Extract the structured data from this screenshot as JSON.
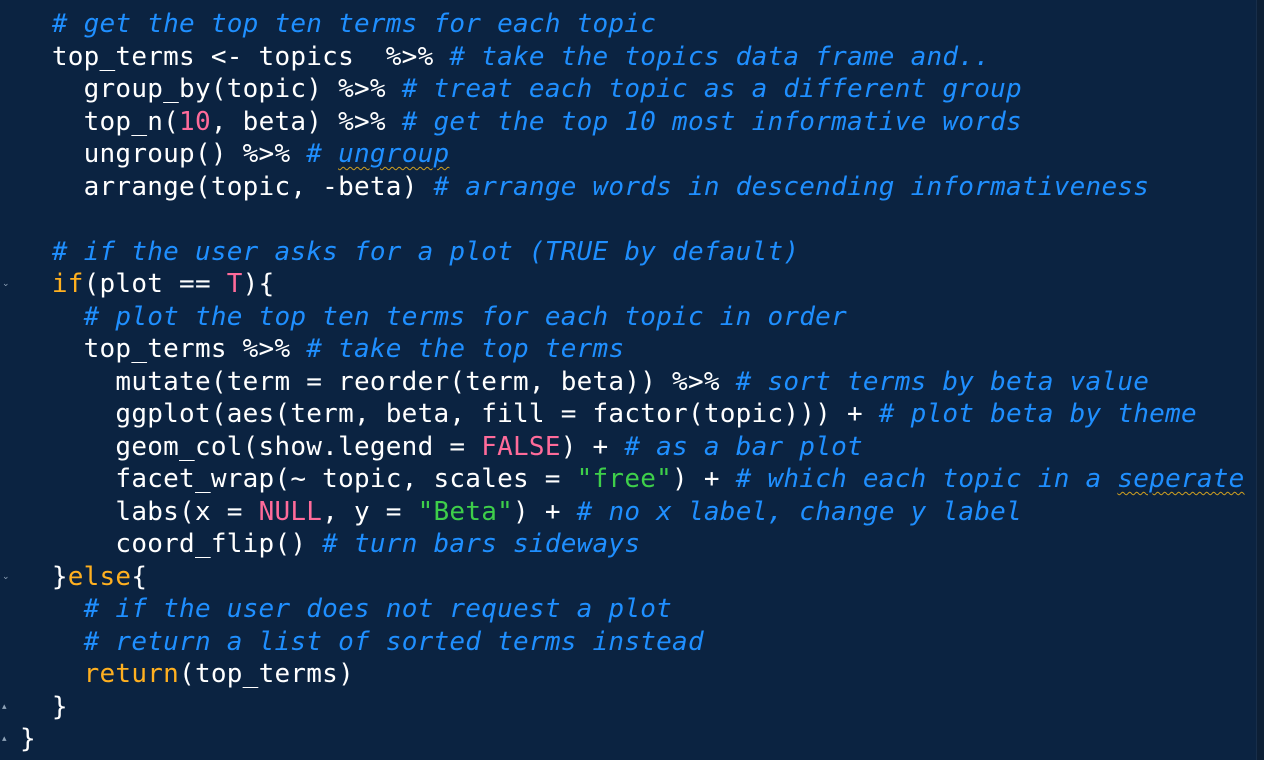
{
  "code_lines": [
    {
      "indent": "  ",
      "tokens": [
        {
          "t": "# get the top ten terms for each topic",
          "k": "c"
        }
      ]
    },
    {
      "indent": "  ",
      "tokens": [
        {
          "t": "top_terms <- topics  %>% ",
          "k": "p"
        },
        {
          "t": "# take the topics data frame and..",
          "k": "c"
        }
      ]
    },
    {
      "indent": "    ",
      "tokens": [
        {
          "t": "group_by(topic) %>% ",
          "k": "p"
        },
        {
          "t": "# treat each topic as a different group",
          "k": "c"
        }
      ]
    },
    {
      "indent": "    ",
      "tokens": [
        {
          "t": "top_n(",
          "k": "p"
        },
        {
          "t": "10",
          "k": "n"
        },
        {
          "t": ", beta) %>% ",
          "k": "p"
        },
        {
          "t": "# get the top 10 most informative words",
          "k": "c"
        }
      ]
    },
    {
      "indent": "    ",
      "tokens": [
        {
          "t": "ungroup() %>% ",
          "k": "p"
        },
        {
          "t": "# ",
          "k": "c"
        },
        {
          "t": "ungroup",
          "k": "c sq"
        }
      ]
    },
    {
      "indent": "    ",
      "tokens": [
        {
          "t": "arrange(topic, -beta) ",
          "k": "p"
        },
        {
          "t": "# arrange words in descending informativeness",
          "k": "c"
        }
      ]
    },
    {
      "indent": "",
      "tokens": []
    },
    {
      "indent": "  ",
      "tokens": [
        {
          "t": "# if the user asks for a plot (TRUE by default)",
          "k": "c"
        }
      ]
    },
    {
      "indent": "  ",
      "tokens": [
        {
          "t": "if",
          "k": "kw"
        },
        {
          "t": "(plot == ",
          "k": "p"
        },
        {
          "t": "T",
          "k": "n"
        },
        {
          "t": "){",
          "k": "p"
        }
      ]
    },
    {
      "indent": "    ",
      "tokens": [
        {
          "t": "# plot the top ten terms for each topic in order",
          "k": "c"
        }
      ]
    },
    {
      "indent": "    ",
      "tokens": [
        {
          "t": "top_terms %>% ",
          "k": "p"
        },
        {
          "t": "# take the top terms",
          "k": "c"
        }
      ]
    },
    {
      "indent": "      ",
      "tokens": [
        {
          "t": "mutate(term = reorder(term, beta)) %>% ",
          "k": "p"
        },
        {
          "t": "# sort terms by beta value",
          "k": "c"
        }
      ]
    },
    {
      "indent": "      ",
      "tokens": [
        {
          "t": "ggplot(aes(term, beta, fill = factor(topic))) + ",
          "k": "p"
        },
        {
          "t": "# plot beta by theme",
          "k": "c"
        }
      ]
    },
    {
      "indent": "      ",
      "tokens": [
        {
          "t": "geom_col(show.legend = ",
          "k": "p"
        },
        {
          "t": "FALSE",
          "k": "n"
        },
        {
          "t": ") + ",
          "k": "p"
        },
        {
          "t": "# as a bar plot",
          "k": "c"
        }
      ]
    },
    {
      "indent": "      ",
      "tokens": [
        {
          "t": "facet_wrap(~ topic, scales = ",
          "k": "p"
        },
        {
          "t": "\"free\"",
          "k": "s"
        },
        {
          "t": ") + ",
          "k": "p"
        },
        {
          "t": "# which each topic in a ",
          "k": "c"
        },
        {
          "t": "seperate",
          "k": "c sq"
        }
      ]
    },
    {
      "indent": "      ",
      "tokens": [
        {
          "t": "labs(x = ",
          "k": "p"
        },
        {
          "t": "NULL",
          "k": "n"
        },
        {
          "t": ", y = ",
          "k": "p"
        },
        {
          "t": "\"Beta\"",
          "k": "s"
        },
        {
          "t": ") + ",
          "k": "p"
        },
        {
          "t": "# no x label, change y label",
          "k": "c"
        }
      ]
    },
    {
      "indent": "      ",
      "tokens": [
        {
          "t": "coord_flip() ",
          "k": "p"
        },
        {
          "t": "# turn bars sideways",
          "k": "c"
        }
      ]
    },
    {
      "indent": "  ",
      "tokens": [
        {
          "t": "}",
          "k": "p"
        },
        {
          "t": "else",
          "k": "kw"
        },
        {
          "t": "{",
          "k": "p"
        }
      ]
    },
    {
      "indent": "    ",
      "tokens": [
        {
          "t": "# if the user does not request a plot",
          "k": "c"
        }
      ]
    },
    {
      "indent": "    ",
      "tokens": [
        {
          "t": "# return a list of sorted terms instead",
          "k": "c"
        }
      ]
    },
    {
      "indent": "    ",
      "tokens": [
        {
          "t": "return",
          "k": "kw"
        },
        {
          "t": "(top_terms)",
          "k": "p"
        }
      ]
    },
    {
      "indent": "  ",
      "tokens": [
        {
          "t": "}",
          "k": "p"
        }
      ]
    },
    {
      "indent": "",
      "tokens": [
        {
          "t": "}",
          "k": "p"
        }
      ]
    }
  ],
  "fold_markers": [
    {
      "line": 8,
      "glyph": "⌄"
    },
    {
      "line": 17,
      "glyph": "⌄"
    },
    {
      "line": 21,
      "glyph": "▴"
    },
    {
      "line": 22,
      "glyph": "▴"
    }
  ],
  "colors": {
    "background": "#0b2341",
    "comment": "#1f8fff",
    "number_constant": "#ff6b9a",
    "string": "#3ecf4a",
    "keyword": "#ffb020",
    "plain": "#ffffff"
  }
}
